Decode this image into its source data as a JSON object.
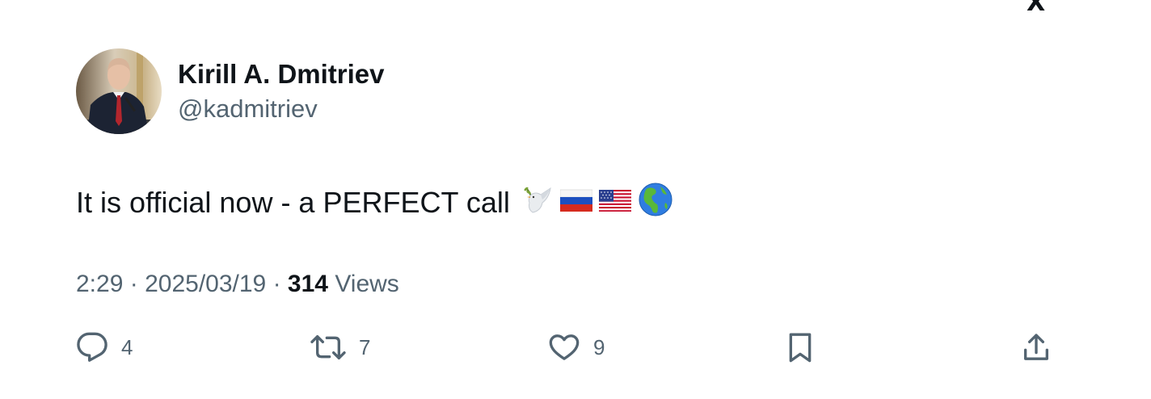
{
  "corner_logo": "X",
  "author": {
    "display_name": "Kirill A. Dmitriev",
    "handle": "@kadmitriev"
  },
  "tweet": {
    "text": "It is official now - a PERFECT call",
    "emojis": [
      "dove-emoji",
      "russia-flag-emoji",
      "usa-flag-emoji",
      "globe-americas-emoji"
    ]
  },
  "meta": {
    "time": "2:29",
    "separator": "·",
    "date": "2025/03/19",
    "views_count": "314",
    "views_label": "Views"
  },
  "actions": {
    "replies": "4",
    "retweets": "7",
    "likes": "9"
  },
  "colors": {
    "primary_text": "#0f1419",
    "secondary_text": "#536471",
    "background": "#ffffff"
  }
}
